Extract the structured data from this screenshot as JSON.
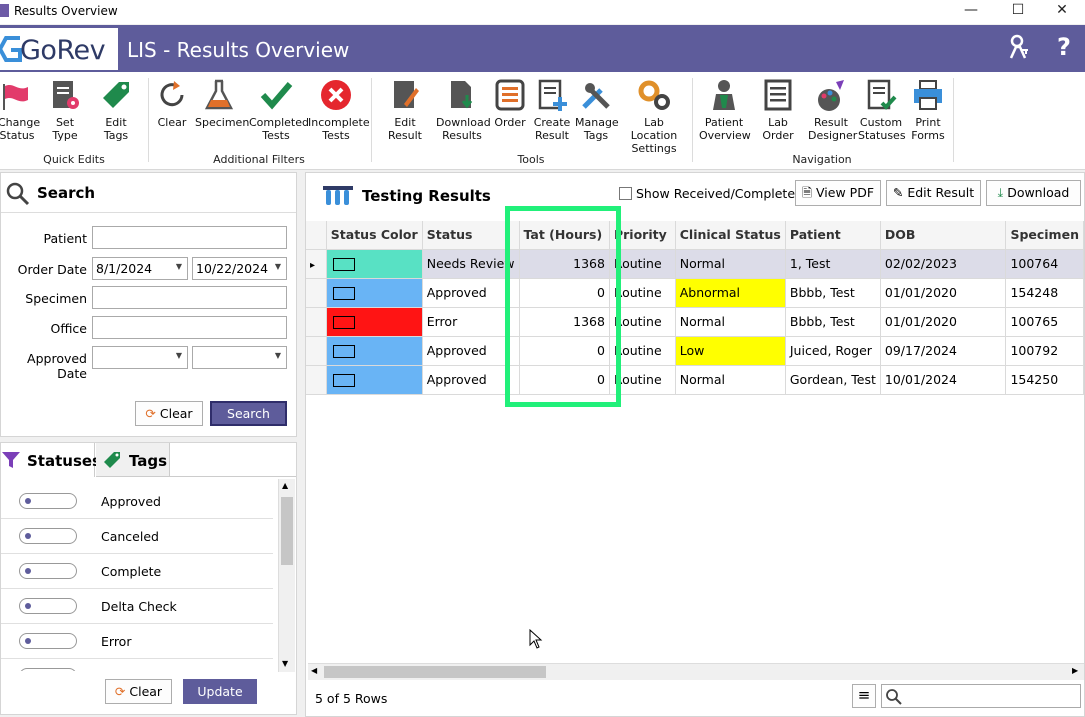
{
  "window": {
    "title": "Results Overview",
    "minimize": "—",
    "maximize": "☐",
    "close": "✕"
  },
  "header": {
    "logo_text": "GoRev",
    "app_title": "LIS - Results Overview",
    "help": "?"
  },
  "ribbon": {
    "quick_edits": {
      "label": "Quick Edits",
      "items": [
        "Change\nStatus",
        "Set Type",
        "Edit Tags"
      ]
    },
    "additional_filters": {
      "label": "Additional Filters",
      "items": [
        "Clear",
        "Specimen",
        "Completed\nTests",
        "Incomplete\nTests"
      ]
    },
    "tools": {
      "label": "Tools",
      "items": [
        "Edit Result",
        "Download\nResults",
        "Order",
        "Create\nResult",
        "Manage\nTags",
        "Lab Location\nSettings"
      ]
    },
    "navigation": {
      "label": "Navigation",
      "items": [
        "Patient\nOverview",
        "Lab Order",
        "Result\nDesigner",
        "Custom\nStatuses",
        "Print\nForms"
      ]
    }
  },
  "search": {
    "title": "Search",
    "patient_label": "Patient",
    "patient_value": "",
    "order_date_label": "Order Date",
    "order_date_from": "8/1/2024",
    "order_date_to": "10/22/2024",
    "specimen_label": "Specimen",
    "specimen_value": "",
    "office_label": "Office",
    "office_value": "",
    "approved_date_label": "Approved Date",
    "approved_date_from": "",
    "approved_date_to": "",
    "clear_label": "Clear",
    "search_label": "Search"
  },
  "filter_tabs": {
    "statuses_label": "Statuses",
    "tags_label": "Tags",
    "statuses": [
      "Approved",
      "Canceled",
      "Complete",
      "Delta Check",
      "Error"
    ],
    "clear_label": "Clear",
    "update_label": "Update"
  },
  "results": {
    "title": "Testing Results",
    "show_received_label": "Show Received/Complete",
    "view_pdf_label": "View PDF",
    "edit_result_label": "Edit Result",
    "download_label": "Download",
    "columns": [
      "Status Color",
      "Status",
      "Tat (Hours)",
      "Priority",
      "Clinical Status",
      "Patient",
      "DOB",
      "Specimen"
    ],
    "rows": [
      {
        "color": "#58e1c4",
        "status": "Needs Review",
        "tat": "1368",
        "priority": "Routine",
        "clinical": "Normal",
        "clinical_bg": "",
        "patient": "1, Test",
        "dob": "02/02/2023",
        "specimen": "100764",
        "selected": true
      },
      {
        "color": "#69b4f5",
        "status": "Approved",
        "tat": "0",
        "priority": "Routine",
        "clinical": "Abnormal",
        "clinical_bg": "#ffff00",
        "patient": "Bbbb, Test",
        "dob": "01/01/2020",
        "specimen": "154248",
        "selected": false
      },
      {
        "color": "#ff1414",
        "status": "Error",
        "tat": "1368",
        "priority": "Routine",
        "clinical": "Normal",
        "clinical_bg": "",
        "patient": "Bbbb, Test",
        "dob": "01/01/2020",
        "specimen": "100765",
        "selected": false
      },
      {
        "color": "#69b4f5",
        "status": "Approved",
        "tat": "0",
        "priority": "Routine",
        "clinical": "Low",
        "clinical_bg": "#ffff00",
        "patient": "Juiced, Roger",
        "dob": "09/17/2024",
        "specimen": "100792",
        "selected": false
      },
      {
        "color": "#69b4f5",
        "status": "Approved",
        "tat": "0",
        "priority": "Routine",
        "clinical": "Normal",
        "clinical_bg": "",
        "patient": "Gordean, Test",
        "dob": "10/01/2024",
        "specimen": "154250",
        "selected": false
      }
    ],
    "row_count": "5 of 5 Rows"
  },
  "colors": {
    "brand": "#5e5c9b",
    "highlight": "#21f07a"
  }
}
